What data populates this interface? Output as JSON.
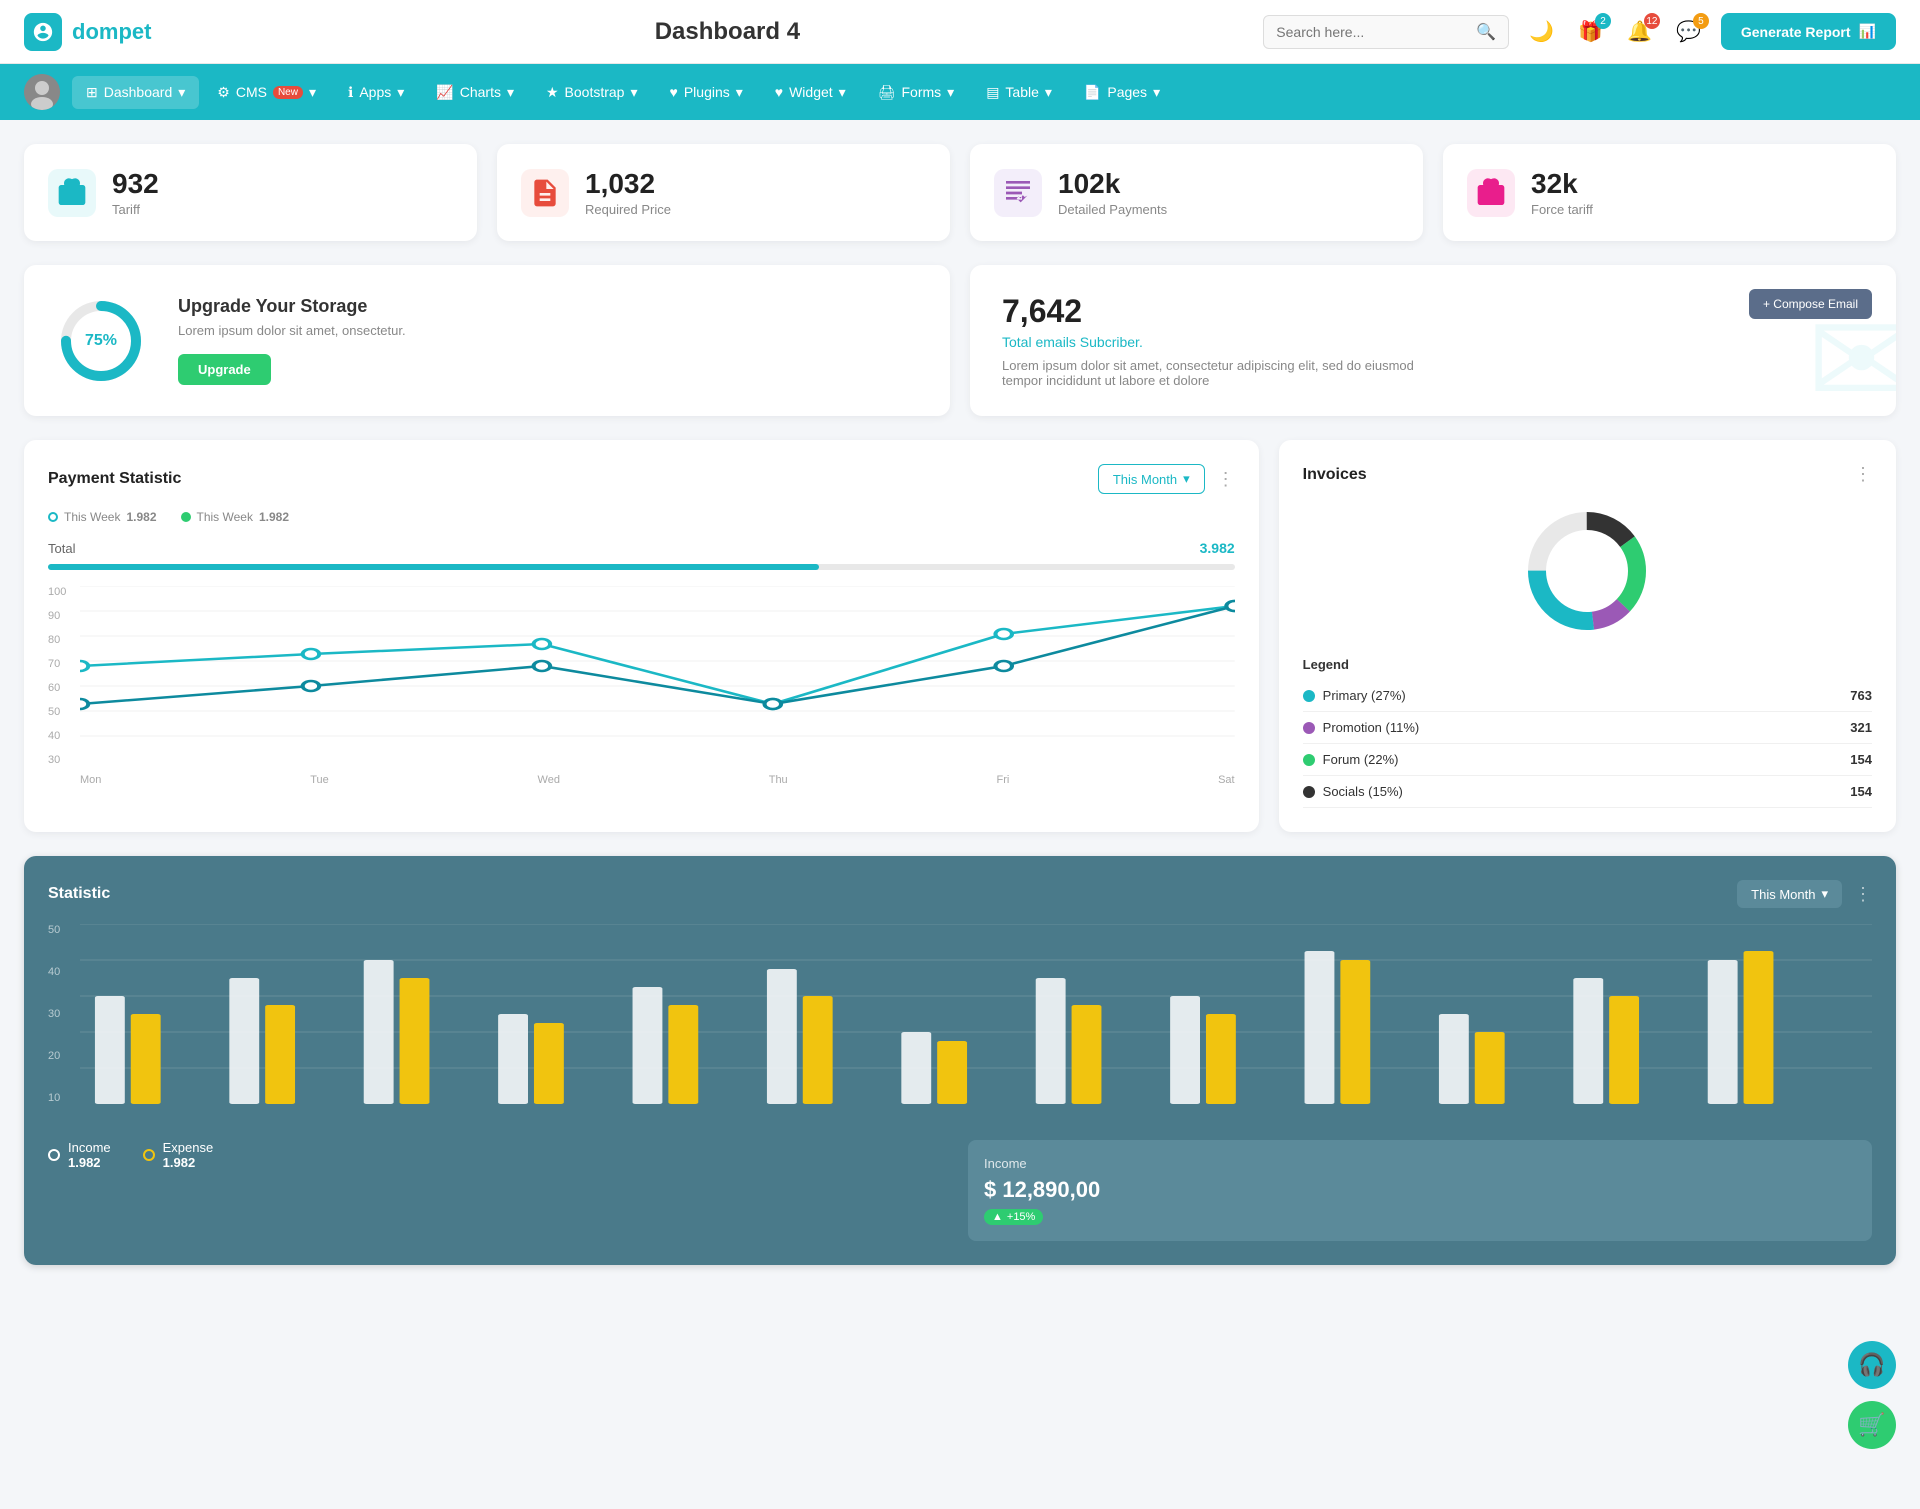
{
  "header": {
    "logo_text": "dompet",
    "page_title": "Dashboard 4",
    "search_placeholder": "Search here...",
    "generate_btn": "Generate Report",
    "icons": {
      "moon": "🌙",
      "gift": "🎁",
      "bell": "🔔",
      "chat": "💬"
    },
    "badges": {
      "gift": "2",
      "bell": "12",
      "chat": "5"
    }
  },
  "nav": {
    "items": [
      {
        "id": "dashboard",
        "label": "Dashboard",
        "active": true
      },
      {
        "id": "cms",
        "label": "CMS",
        "badge": "New"
      },
      {
        "id": "apps",
        "label": "Apps"
      },
      {
        "id": "charts",
        "label": "Charts"
      },
      {
        "id": "bootstrap",
        "label": "Bootstrap"
      },
      {
        "id": "plugins",
        "label": "Plugins"
      },
      {
        "id": "widget",
        "label": "Widget"
      },
      {
        "id": "forms",
        "label": "Forms"
      },
      {
        "id": "table",
        "label": "Table"
      },
      {
        "id": "pages",
        "label": "Pages"
      }
    ]
  },
  "stat_cards": [
    {
      "id": "tariff",
      "num": "932",
      "label": "Tariff",
      "icon_color": "#1bb8c5"
    },
    {
      "id": "required_price",
      "num": "1,032",
      "label": "Required Price",
      "icon_color": "#e74c3c"
    },
    {
      "id": "detailed_payments",
      "num": "102k",
      "label": "Detailed Payments",
      "icon_color": "#9b59b6"
    },
    {
      "id": "force_tariff",
      "num": "32k",
      "label": "Force tariff",
      "icon_color": "#e91e8c"
    }
  ],
  "storage": {
    "percent": "75%",
    "percent_num": 75,
    "title": "Upgrade Your Storage",
    "desc": "Lorem ipsum dolor sit amet, onsectetur.",
    "btn": "Upgrade"
  },
  "email": {
    "num": "7,642",
    "label": "Total emails Subcriber.",
    "desc": "Lorem ipsum dolor sit amet, consectetur adipiscing elit, sed do eiusmod tempor incididunt ut labore et dolore",
    "compose_btn": "+ Compose Email"
  },
  "payment": {
    "title": "Payment Statistic",
    "this_month_btn": "This Month",
    "legend": [
      {
        "label": "This Week",
        "color": "#1bb8c5",
        "val": "1.982",
        "filled": false
      },
      {
        "label": "This Week",
        "color": "#2ecc71",
        "val": "1.982",
        "filled": true
      }
    ],
    "total_label": "Total",
    "total_val": "3.982",
    "progress_pct": 65,
    "x_labels": [
      "Mon",
      "Tue",
      "Wed",
      "Thu",
      "Fri",
      "Sat"
    ],
    "y_labels": [
      "100",
      "90",
      "80",
      "70",
      "60",
      "50",
      "40",
      "30"
    ],
    "line1_points": "0,60 100,70 200,78 300,40 400,65 500,90 600,88",
    "line2_points": "0,40 100,51 200,65 300,40 400,65 500,63 600,88"
  },
  "invoices": {
    "title": "Invoices",
    "legend": [
      {
        "label": "Primary (27%)",
        "color": "#1bb8c5",
        "count": "763"
      },
      {
        "label": "Promotion (11%)",
        "color": "#9b59b6",
        "count": "321"
      },
      {
        "label": "Forum (22%)",
        "color": "#2ecc71",
        "count": "154"
      },
      {
        "label": "Socials (15%)",
        "color": "#333",
        "count": "154"
      }
    ],
    "legend_title": "Legend"
  },
  "statistic": {
    "title": "Statistic",
    "this_month_btn": "This Month",
    "y_labels": [
      "50",
      "40",
      "30",
      "20",
      "10"
    ],
    "income_legend": "Income",
    "income_val": "1.982",
    "expense_legend": "Expense",
    "expense_val": "1.982",
    "income_box": {
      "title": "Income",
      "val": "$ 12,890,00",
      "badge": "+15%"
    }
  }
}
